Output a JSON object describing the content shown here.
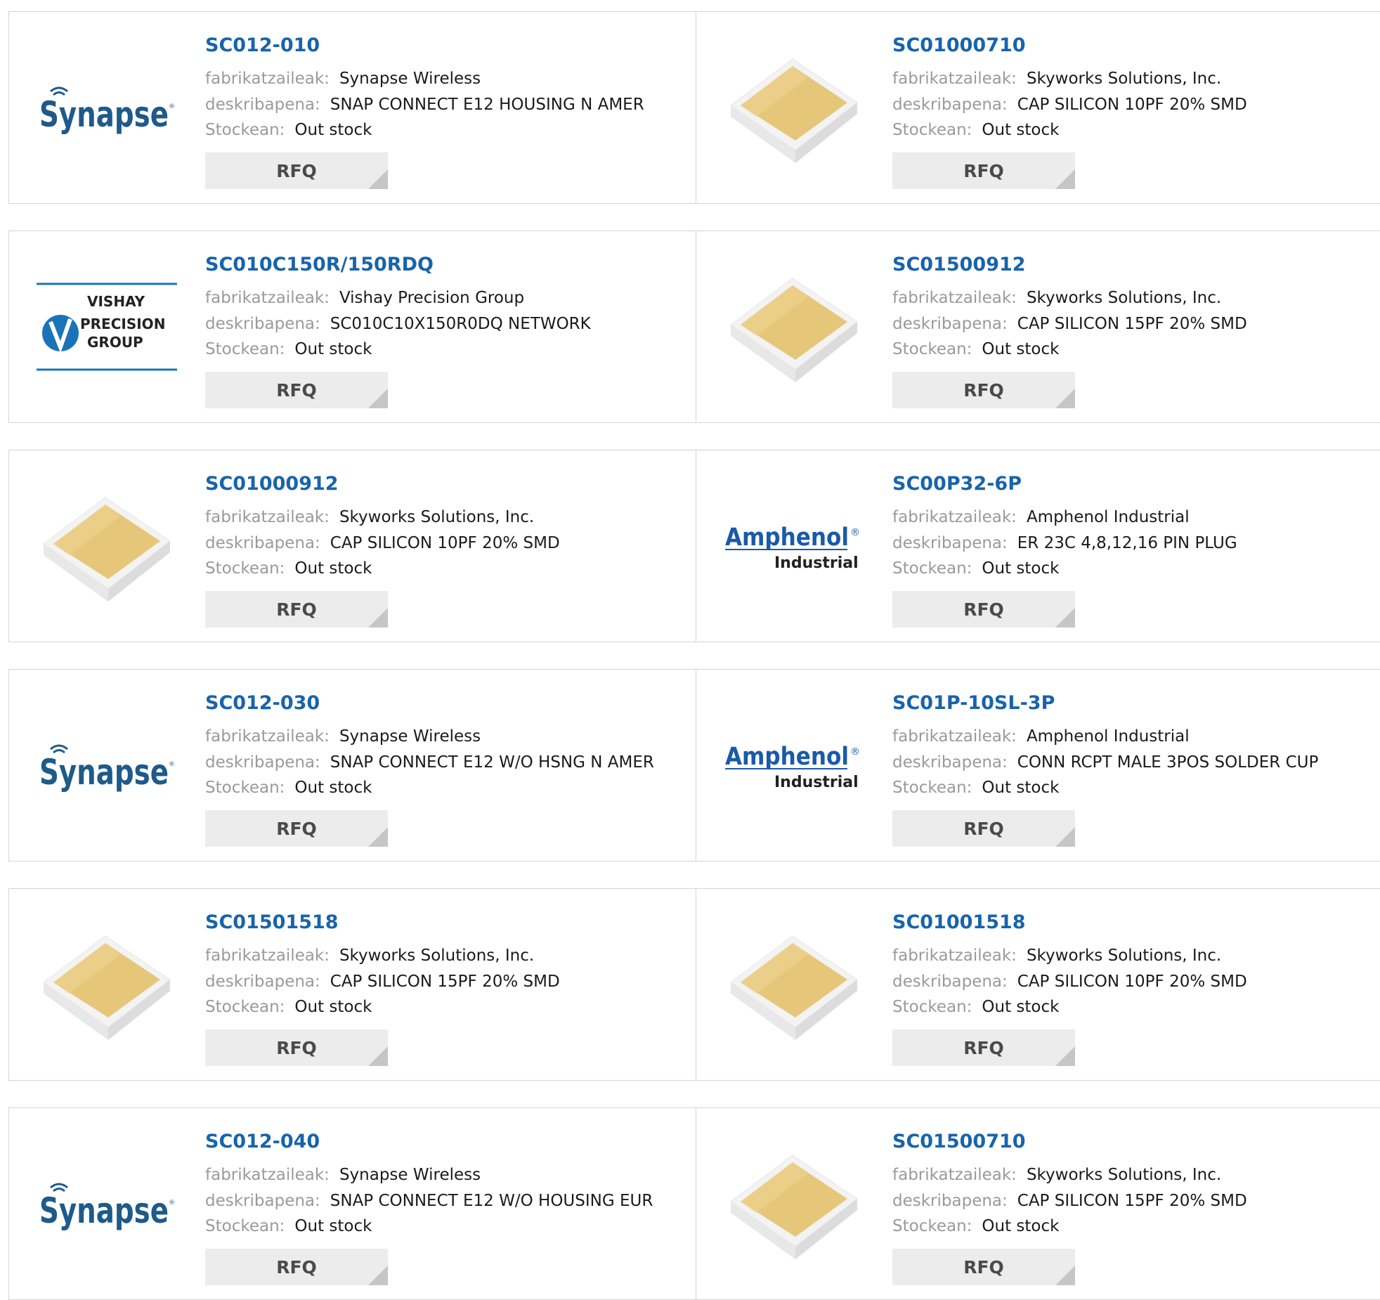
{
  "labels": {
    "manufacturer": "fabrikatzaileak:",
    "description": "deskribapena:",
    "stock": "Stockean:",
    "rfq": "RFQ"
  },
  "logos": {
    "synapse": "Synapse",
    "vishay": [
      "VISHAY",
      "PRECISION",
      "GROUP"
    ],
    "amphenol": [
      "Amphenol",
      "®",
      "Industrial"
    ]
  },
  "products": [
    {
      "part": "SC012-010",
      "manufacturer": "Synapse Wireless",
      "description": "SNAP CONNECT E12 HOUSING N AMER",
      "stock": "Out stock",
      "image": "synapse-logo"
    },
    {
      "part": "SC01000710",
      "manufacturer": "Skyworks Solutions, Inc.",
      "description": "CAP SILICON 10PF 20% SMD",
      "stock": "Out stock",
      "image": "chip-image"
    },
    {
      "part": "SC010C150R/150RDQ",
      "manufacturer": "Vishay Precision Group",
      "description": "SC010C10X150R0DQ NETWORK",
      "stock": "Out stock",
      "image": "vishay-logo"
    },
    {
      "part": "SC01500912",
      "manufacturer": "Skyworks Solutions, Inc.",
      "description": "CAP SILICON 15PF 20% SMD",
      "stock": "Out stock",
      "image": "chip-image"
    },
    {
      "part": "SC01000912",
      "manufacturer": "Skyworks Solutions, Inc.",
      "description": "CAP SILICON 10PF 20% SMD",
      "stock": "Out stock",
      "image": "chip-image"
    },
    {
      "part": "SC00P32-6P",
      "manufacturer": "Amphenol Industrial",
      "description": "ER 23C 4,8,12,16 PIN PLUG",
      "stock": "Out stock",
      "image": "amphenol-logo"
    },
    {
      "part": "SC012-030",
      "manufacturer": "Synapse Wireless",
      "description": "SNAP CONNECT E12 W/O HSNG N AMER",
      "stock": "Out stock",
      "image": "synapse-logo"
    },
    {
      "part": "SC01P-10SL-3P",
      "manufacturer": "Amphenol Industrial",
      "description": "CONN RCPT MALE 3POS SOLDER CUP",
      "stock": "Out stock",
      "image": "amphenol-logo"
    },
    {
      "part": "SC01501518",
      "manufacturer": "Skyworks Solutions, Inc.",
      "description": "CAP SILICON 15PF 20% SMD",
      "stock": "Out stock",
      "image": "chip-image"
    },
    {
      "part": "SC01001518",
      "manufacturer": "Skyworks Solutions, Inc.",
      "description": "CAP SILICON 10PF 20% SMD",
      "stock": "Out stock",
      "image": "chip-image"
    },
    {
      "part": "SC012-040",
      "manufacturer": "Synapse Wireless",
      "description": "SNAP CONNECT E12 W/O HOUSING EUR",
      "stock": "Out stock",
      "image": "synapse-logo"
    },
    {
      "part": "SC01500710",
      "manufacturer": "Skyworks Solutions, Inc.",
      "description": "CAP SILICON 15PF 20% SMD",
      "stock": "Out stock",
      "image": "chip-image"
    }
  ],
  "colors": {
    "link": "#1864ab",
    "label": "#9a9a9a",
    "button_bg": "#ececec",
    "synapse": "#1e5a8a",
    "vishay": "#1a73b8",
    "amphenol": "#1a5aa8",
    "chip_gold": "#e6c77a"
  }
}
